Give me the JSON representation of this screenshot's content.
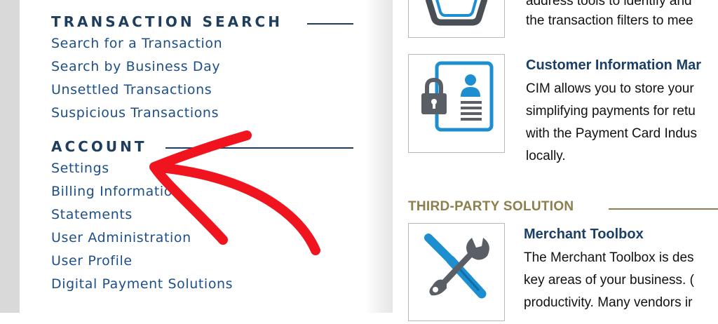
{
  "nav": {
    "transaction_search": {
      "heading": "TRANSACTION SEARCH",
      "links": [
        "Search for a Transaction",
        "Search by Business Day",
        "Unsettled Transactions",
        "Suspicious Transactions"
      ]
    },
    "account": {
      "heading": "ACCOUNT",
      "links": [
        "Settings",
        "Billing Information",
        "Statements",
        "User Administration",
        "User Profile",
        "Digital Payment Solutions"
      ]
    }
  },
  "content": {
    "top_item": {
      "lines": [
        "address tools to identify and",
        "the transaction filters to mee"
      ],
      "icon": "shield-icon"
    },
    "cim": {
      "title": "Customer Information Mar",
      "lines": [
        "CIM allows you to store your",
        "simplifying payments for retu",
        "with the Payment Card Indus",
        "locally."
      ],
      "icon": "lock-profile-card-icon"
    },
    "third_party": {
      "heading": "THIRD-PARTY SOLUTION",
      "title": "Merchant Toolbox",
      "lines": [
        "The Merchant Toolbox is des",
        "key areas of your business. (",
        "productivity. Many vendors ir"
      ],
      "icon": "wrench-screwdriver-icon"
    }
  },
  "annotation": {
    "arrow_color": "#f0141e"
  },
  "colors": {
    "nav_heading": "#1f3d5c",
    "nav_link": "#1c4f8a",
    "third_party": "#8d7f4c",
    "accent_blue": "#1d8fd0"
  }
}
